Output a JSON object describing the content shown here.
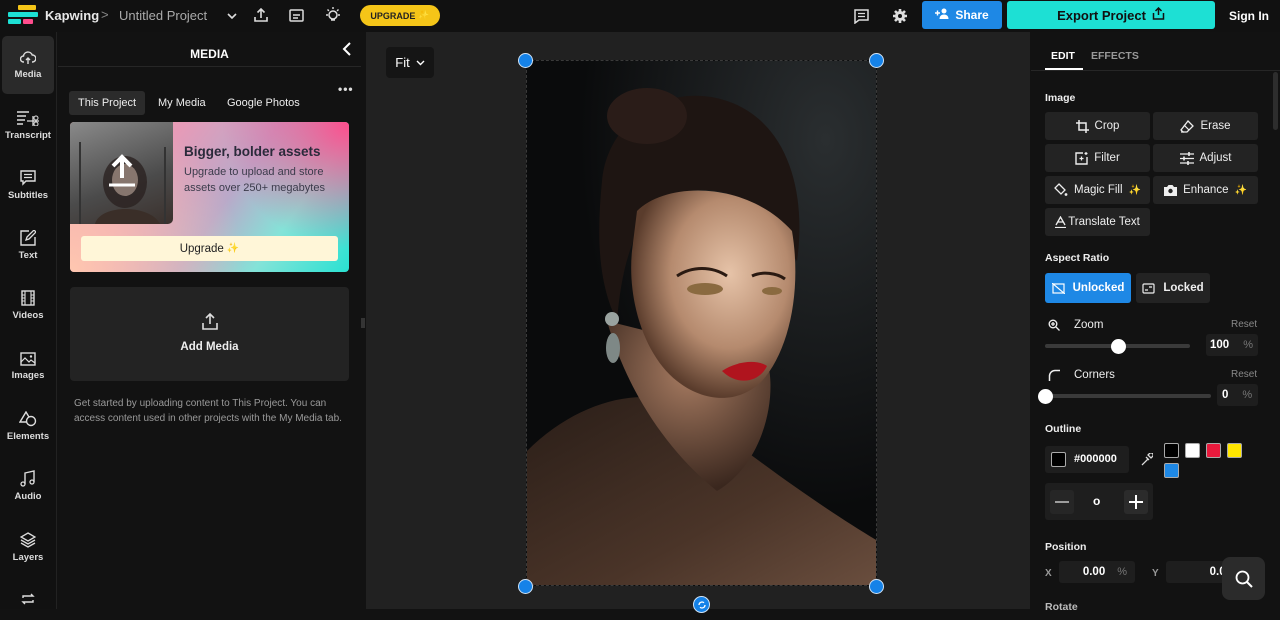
{
  "topbar": {
    "brand": "Kapwing",
    "separator": ">",
    "project_title": "Untitled Project",
    "upgrade_label": "UPGRADE",
    "share_label": "Share",
    "export_label": "Export Project",
    "signin_label": "Sign In",
    "icons": [
      "kapwing-logo",
      "chevron-down-icon",
      "upload-icon",
      "subtitles-icon",
      "lightbulb-icon",
      "comment-icon",
      "gear-icon",
      "add-user-icon",
      "export-icon"
    ]
  },
  "leftnav": {
    "items": [
      {
        "label": "Media",
        "icon": "cloud-upload-icon",
        "active": true
      },
      {
        "label": "Transcript",
        "icon": "transcript-scissors-icon"
      },
      {
        "label": "Subtitles",
        "icon": "subtitles-icon"
      },
      {
        "label": "Text",
        "icon": "text-edit-icon"
      },
      {
        "label": "Videos",
        "icon": "film-icon"
      },
      {
        "label": "Images",
        "icon": "image-icon"
      },
      {
        "label": "Elements",
        "icon": "shapes-icon"
      },
      {
        "label": "Audio",
        "icon": "music-note-icon"
      },
      {
        "label": "Layers",
        "icon": "layers-icon"
      },
      {
        "label": "",
        "icon": "loop-icon"
      }
    ]
  },
  "media_panel": {
    "title": "MEDIA",
    "tabs": [
      {
        "label": "This Project",
        "active": true
      },
      {
        "label": "My Media"
      },
      {
        "label": "Google Photos"
      }
    ],
    "promo": {
      "title": "Bigger, bolder assets",
      "text": "Upgrade to upload and store assets over 250+ megabytes",
      "button_label": "Upgrade"
    },
    "add_media_label": "Add Media",
    "help_text": "Get started by uploading content to This Project. You can access content used in other projects with the My Media tab."
  },
  "canvas": {
    "zoom_select": "Fit",
    "handle_color": "#1582e8"
  },
  "right_panel": {
    "tabs": [
      {
        "label": "EDIT",
        "active": true
      },
      {
        "label": "EFFECTS"
      }
    ],
    "image_section": "Image",
    "tools": [
      {
        "label": "Crop",
        "icon": "crop-icon"
      },
      {
        "label": "Erase",
        "icon": "eraser-icon"
      },
      {
        "label": "Filter",
        "icon": "filter-icon"
      },
      {
        "label": "Adjust",
        "icon": "sliders-icon"
      },
      {
        "label": "Magic Fill",
        "icon": "paint-bucket-icon",
        "sparkle": true
      },
      {
        "label": "Enhance",
        "icon": "camera-icon",
        "sparkle": true
      },
      {
        "label": "Translate Text",
        "icon": "translate-icon"
      }
    ],
    "aspect_ratio": {
      "label": "Aspect Ratio",
      "options": [
        {
          "label": "Unlocked",
          "active": true
        },
        {
          "label": "Locked"
        }
      ]
    },
    "zoom": {
      "label": "Zoom",
      "reset": "Reset",
      "value": "100",
      "unit": "%",
      "fraction": 0.5
    },
    "corners": {
      "label": "Corners",
      "reset": "Reset",
      "value": "0",
      "unit": "%",
      "fraction": 0.0
    },
    "outline": {
      "label": "Outline",
      "color_value": "#000000",
      "swatches": [
        "#000000",
        "#ffffff",
        "#e8193c",
        "#ffe600",
        "#1e88e5"
      ],
      "width_value": "o"
    },
    "position": {
      "label": "Position",
      "x_label": "X",
      "x_value": "0.00",
      "x_unit": "%",
      "y_label": "Y",
      "y_value": "0.00"
    },
    "rotate_label": "Rotate"
  },
  "colors": {
    "accent_blue": "#1e88e5",
    "export_teal": "#1de0d4",
    "upgrade_yellow": "#f5c518"
  }
}
